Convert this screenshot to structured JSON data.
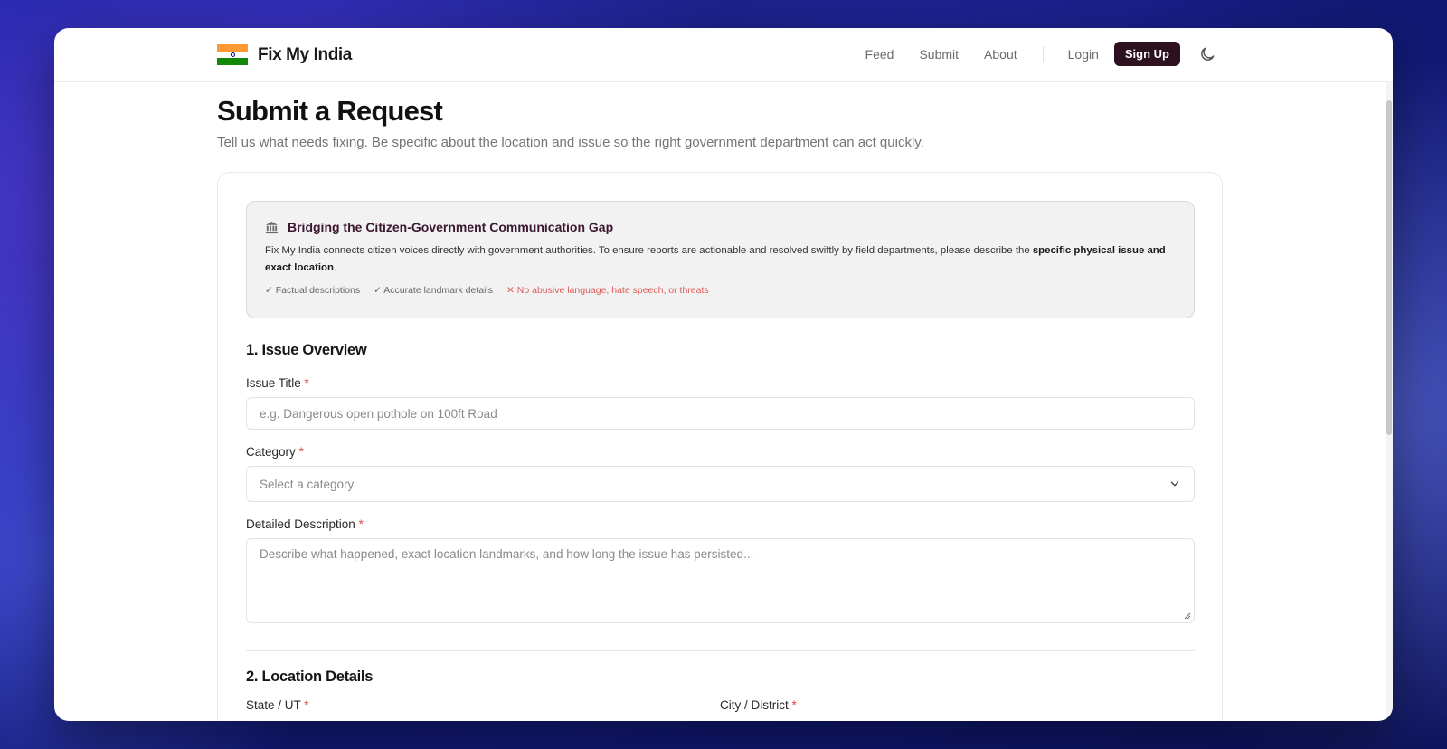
{
  "nav": {
    "brand": "Fix My India",
    "links": [
      "Feed",
      "Submit",
      "About"
    ],
    "login": "Login",
    "signup": "Sign Up"
  },
  "page": {
    "title": "Submit a Request",
    "subtitle": "Tell us what needs fixing. Be specific about the location and issue so the right government department can act quickly."
  },
  "info": {
    "title": "Bridging the Citizen-Government Communication Gap",
    "text_before": "Fix My India connects citizen voices directly with government authorities. To ensure reports are actionable and resolved swiftly by field departments, please describe the ",
    "text_bold": "specific physical issue and exact location",
    "text_after": ".",
    "checks": [
      "✓ Factual descriptions",
      "✓ Accurate landmark details"
    ],
    "warning": "✕ No abusive language, hate speech, or threats"
  },
  "section1": {
    "title": "1. Issue Overview",
    "issue_title_label": "Issue Title",
    "issue_title_placeholder": "e.g. Dangerous open pothole on 100ft Road",
    "category_label": "Category",
    "category_value": "Select a category",
    "description_label": "Detailed Description",
    "description_placeholder": "Describe what happened, exact location landmarks, and how long the issue has persisted..."
  },
  "section2": {
    "title": "2. Location Details",
    "state_label": "State / UT",
    "city_label": "City / District"
  },
  "required_mark": "*",
  "colors": {
    "accent": "#2d1120",
    "required": "#e04343",
    "warning": "#e25a5a"
  }
}
